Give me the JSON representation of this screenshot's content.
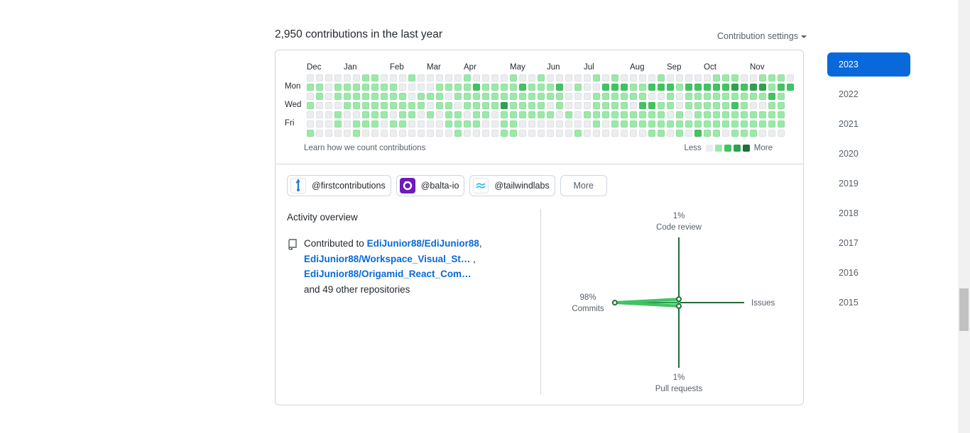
{
  "heading": "2,950 contributions in the last year",
  "settings_label": "Contribution settings",
  "calendar": {
    "months": [
      {
        "label": "Dec",
        "week": 0
      },
      {
        "label": "Jan",
        "week": 4
      },
      {
        "label": "Feb",
        "week": 9
      },
      {
        "label": "Mar",
        "week": 13
      },
      {
        "label": "Apr",
        "week": 17
      },
      {
        "label": "May",
        "week": 22
      },
      {
        "label": "Jun",
        "week": 26
      },
      {
        "label": "Jul",
        "week": 30
      },
      {
        "label": "Aug",
        "week": 35
      },
      {
        "label": "Sep",
        "week": 39
      },
      {
        "label": "Oct",
        "week": 43
      },
      {
        "label": "Nov",
        "week": 48
      }
    ],
    "day_labels": [
      {
        "label": "Mon",
        "row": 1
      },
      {
        "label": "Wed",
        "row": 3
      },
      {
        "label": "Fri",
        "row": 5
      }
    ],
    "level_colors": [
      "#ebedf0",
      "#9be9a8",
      "#40c463",
      "#30a14e",
      "#216e39"
    ],
    "rows": [
      "00000011000100000100001001000001010000100000111001110",
      "11011111110000111121111211120100222112221222223233122",
      "0101111111101110111111111111000111111001011111111121",
      "1000111111111011011113111101000111102211011111210011",
      "0001001110110101101101111110101111111110101111111111",
      "0001011101100001111001100000000101111111111111111111",
      "1000010000000000100001100000010000000110102110111000"
    ],
    "learn_link": "Learn how we count contributions",
    "legend_less": "Less",
    "legend_more": "More"
  },
  "organizations": [
    {
      "label": "@firstcontributions",
      "icon": "first-contributions-logo"
    },
    {
      "label": "@balta-io",
      "icon": "balta-io-logo"
    },
    {
      "label": "@tailwindlabs",
      "icon": "tailwind-logo"
    }
  ],
  "more_label": "More",
  "activity": {
    "title": "Activity overview",
    "prefix": "Contributed to ",
    "repos": [
      "EdiJunior88/EdiJunior88",
      "EdiJunior88/Workspace_Visual_St…",
      "EdiJunior88/Origamid_React_Com…"
    ],
    "sep1": ",",
    "sep2": " ,",
    "suffix": "and 49 other repositories"
  },
  "radar": {
    "code_review": {
      "pct": "1%",
      "label": "Code review",
      "value": 1
    },
    "issues": {
      "pct": "",
      "label": "Issues",
      "value": 0
    },
    "pull_requests": {
      "pct": "1%",
      "label": "Pull requests",
      "value": 1
    },
    "commits": {
      "pct": "98%",
      "label": "Commits",
      "value": 98
    },
    "line_color": "#216e39",
    "fill_color": "#40c463"
  },
  "years": [
    "2023",
    "2022",
    "2021",
    "2020",
    "2019",
    "2018",
    "2017",
    "2016",
    "2015"
  ],
  "selected_year": "2023"
}
